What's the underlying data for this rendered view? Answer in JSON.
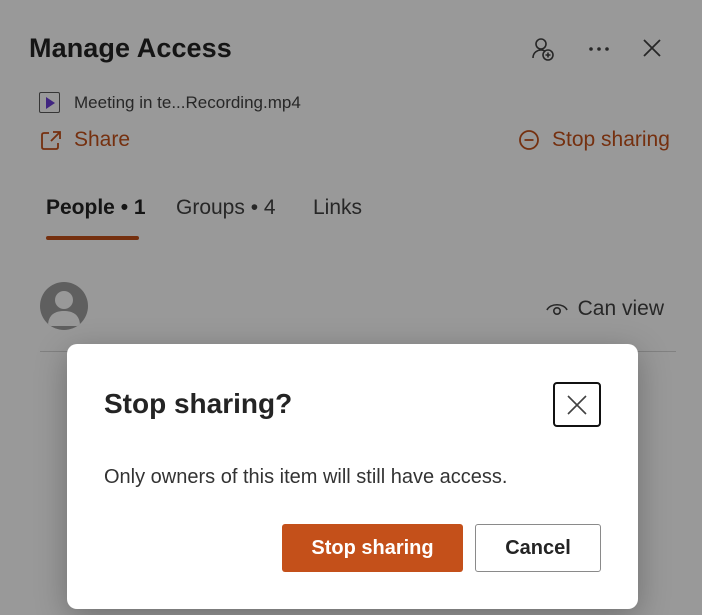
{
  "panel": {
    "title": "Manage Access",
    "file_name": "Meeting in te...Recording.mp4",
    "share_label": "Share",
    "stop_sharing_label": "Stop sharing",
    "tabs": [
      {
        "label": "People • 1"
      },
      {
        "label": "Groups • 4"
      },
      {
        "label": "Links"
      }
    ],
    "person": {
      "permission": "Can view"
    },
    "icons": [
      "add-person-icon",
      "more-icon",
      "close-icon",
      "video-file-icon",
      "share-icon",
      "stop-circle-icon",
      "eye-icon"
    ]
  },
  "dialog": {
    "title": "Stop sharing?",
    "message": "Only owners of this item will still have access.",
    "confirm_label": "Stop sharing",
    "cancel_label": "Cancel"
  },
  "colors": {
    "accent": "#c4501a",
    "overlay": "rgba(0,0,0,0.4)"
  }
}
